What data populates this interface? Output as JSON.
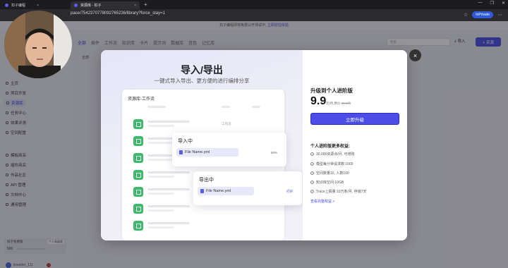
{
  "browser": {
    "tabs": [
      {
        "label": "扣子编程",
        "close": "×"
      },
      {
        "label": "资源库 - 扣子",
        "close": "×"
      }
    ],
    "new_tab": "+",
    "url": "pace/7542370778092765236/library?force_stay=1",
    "inprivate": "InPrivate",
    "window_controls": [
      "—",
      "❐",
      "✕"
    ]
  },
  "app": {
    "notice_text": "扣子编程即将免费公开测试中,",
    "notice_link": "立即前往体验",
    "nav": [
      "全部",
      "插件",
      "工作流",
      "知识库",
      "卡片",
      "提示词",
      "数据库",
      "音色",
      "记忆库"
    ],
    "filter_all": "全部",
    "search_placeholder": "搜索",
    "import_label": "导入",
    "resource_label": "+ 资源",
    "sidebar": [
      {
        "label": "主页"
      },
      {
        "label": "项目开发"
      },
      {
        "label": "资源库"
      },
      {
        "label": "任务中心"
      },
      {
        "label": "效果评测"
      },
      {
        "label": "空间配置"
      },
      {
        "label": "模板商店"
      },
      {
        "label": "插件商店"
      },
      {
        "label": "作品社区"
      },
      {
        "label": "API 管理"
      },
      {
        "label": "文档中心"
      },
      {
        "label": "通用管理"
      }
    ],
    "plan_card": {
      "label": "扣子免费版",
      "badge": "个人高级版",
      "count": "500"
    },
    "user_name": "linestter_111"
  },
  "modal": {
    "title": "导入/导出",
    "subtitle": "一键式导入导出、更方便的进行编排分享",
    "card_title": "资源库-工作流",
    "row_tag": "工作流",
    "import": {
      "title": "导入中",
      "file": "File Name.yml",
      "pct": "50%"
    },
    "export": {
      "title": "导出中",
      "file": "File Name.yml",
      "link": "打开"
    },
    "upgrade_title": "升级到个人进阶版",
    "price": "9.9",
    "price_unit": "元/月,原价",
    "original_price": "39.9元",
    "upgrade_button": "立即升级",
    "benefits_title": "个人进阶版更多权益:",
    "benefits": [
      "30,000资源点/月, 可增购",
      "模型每分钟请求数:1000",
      "空间数量10, 人数100",
      "知识库空间:10GB",
      "Trace上报量:10万条/月, 存储7天"
    ],
    "more_link": "查看完整权益 >",
    "close": "×"
  },
  "colors": {
    "accent": "#4b4de6",
    "green": "#3dbb6a"
  }
}
